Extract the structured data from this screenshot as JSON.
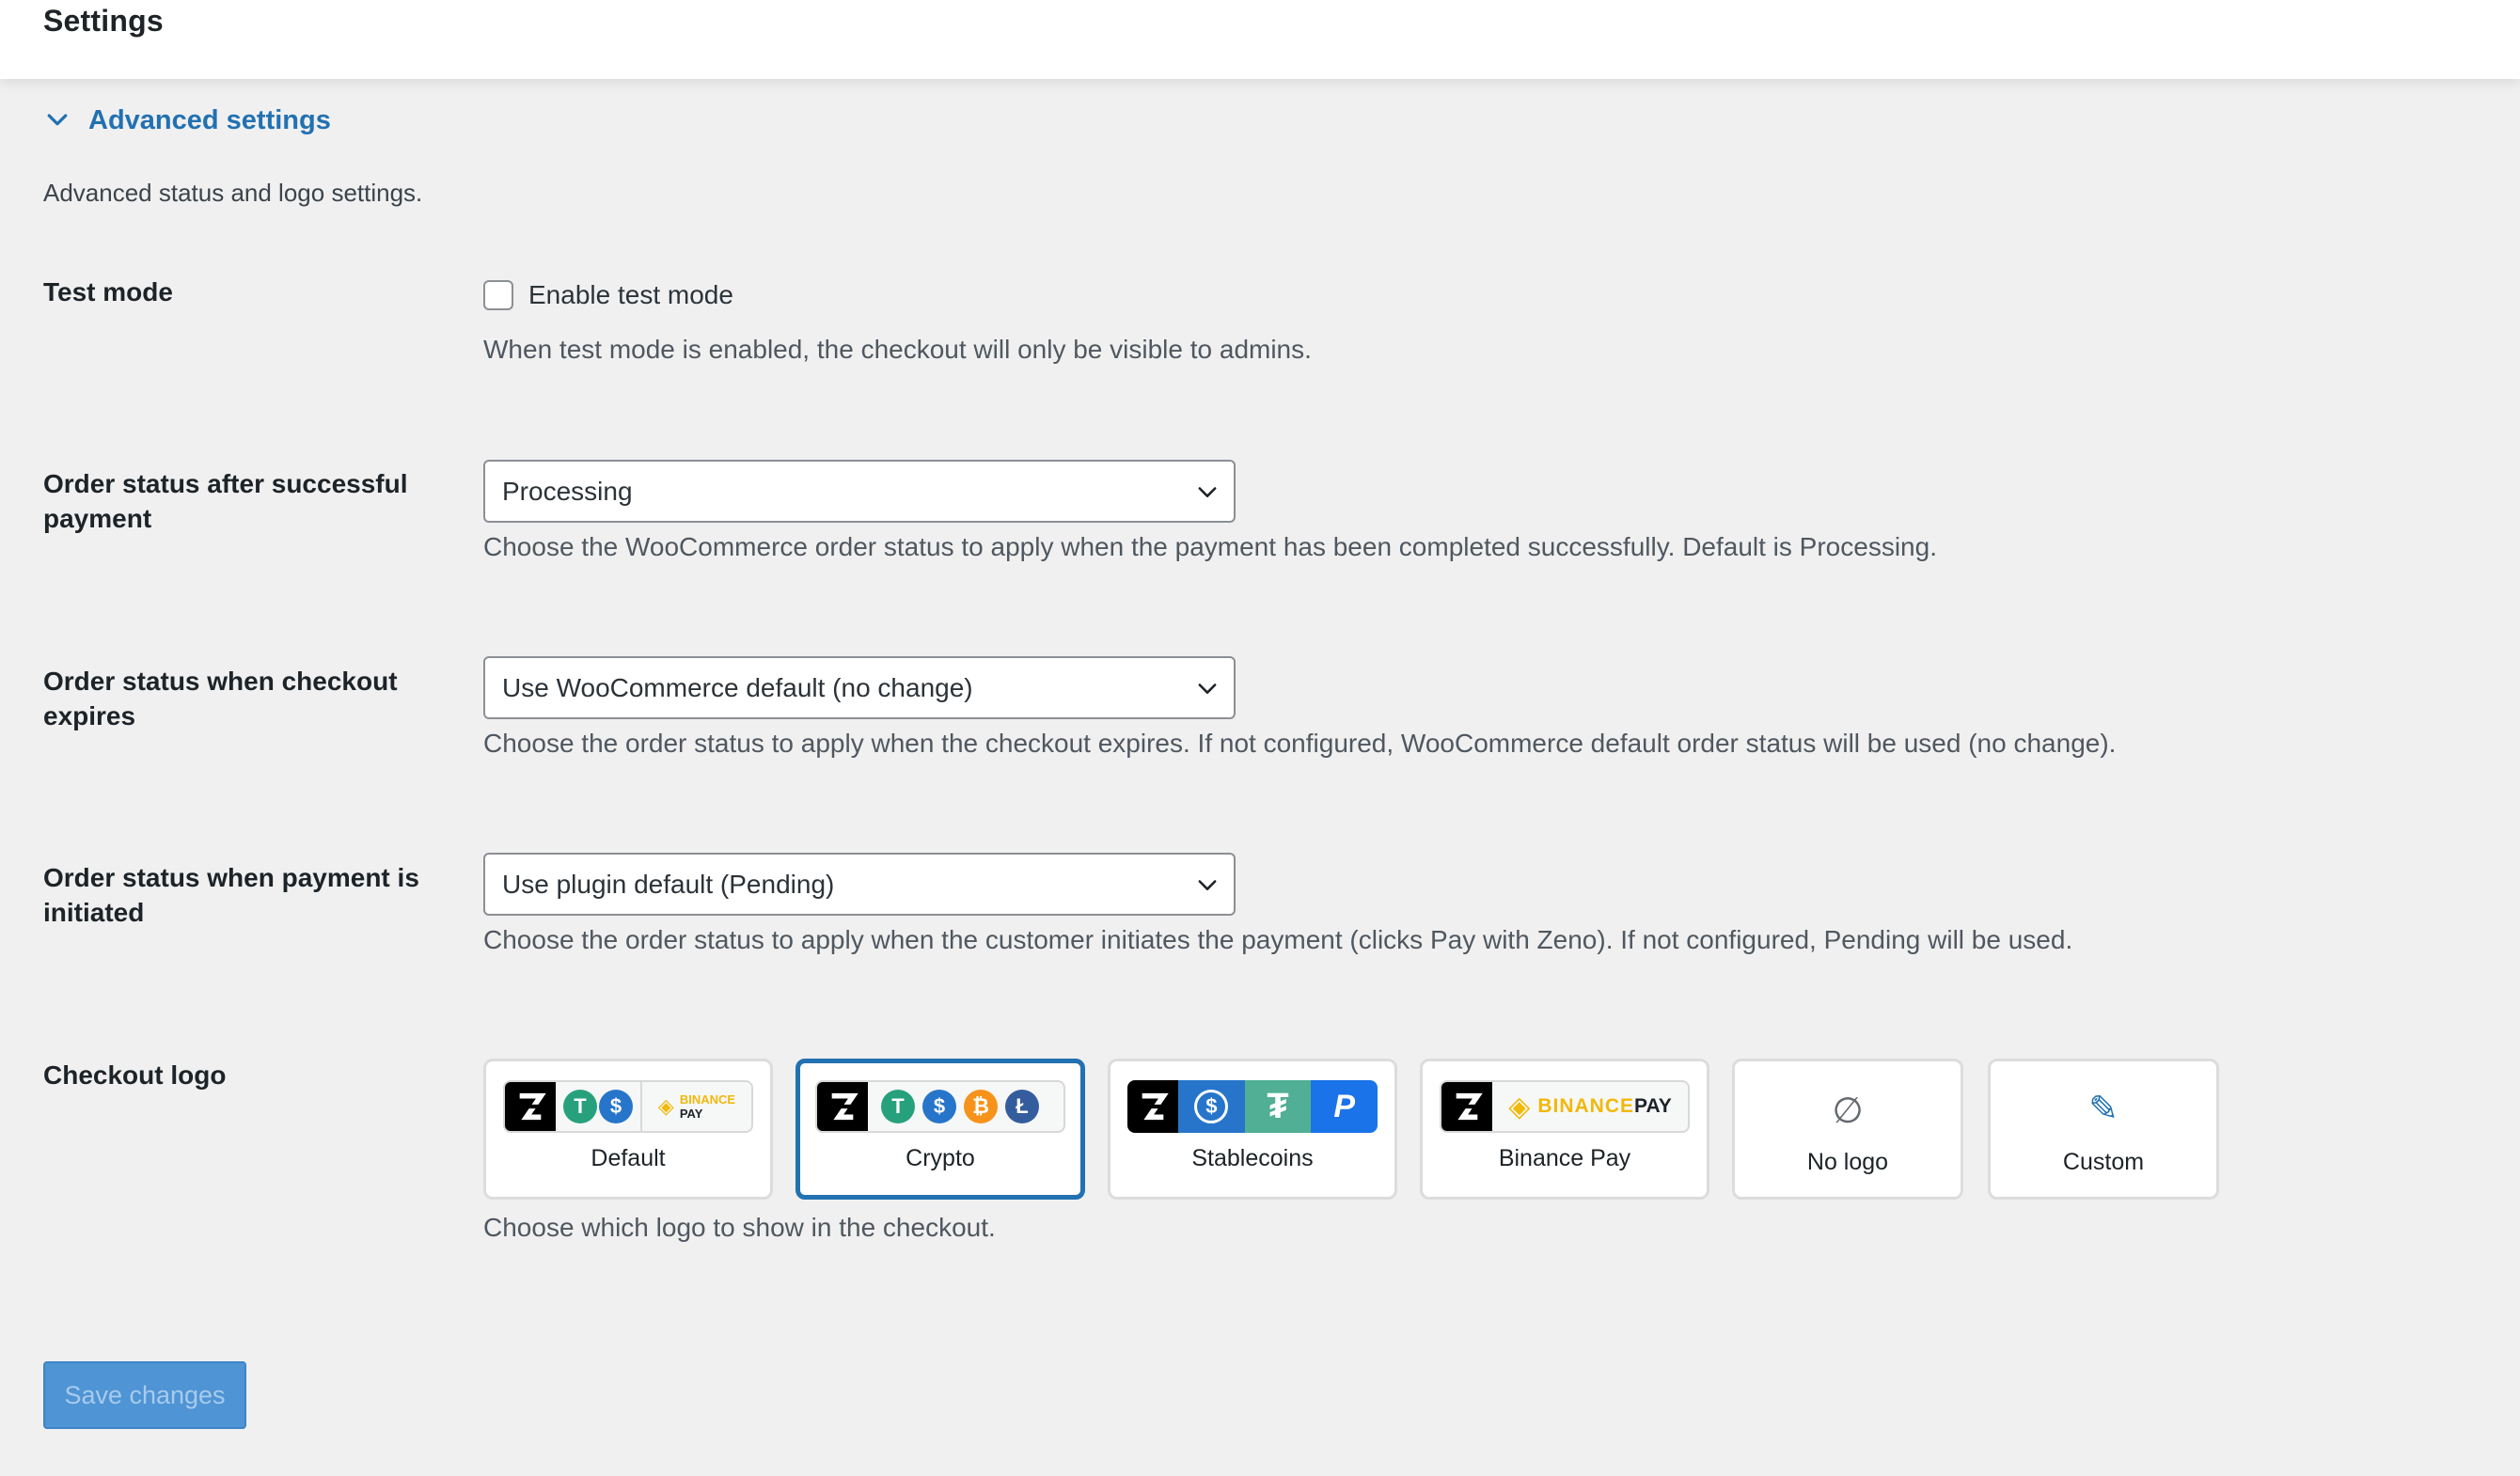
{
  "header": {
    "title": "Settings"
  },
  "advanced": {
    "toggle_label": "Advanced settings",
    "description": "Advanced status and logo settings."
  },
  "test_mode": {
    "label": "Test mode",
    "checkbox_label": "Enable test mode",
    "checked": false,
    "help": "When test mode is enabled, the checkout will only be visible to admins."
  },
  "order_success": {
    "label": "Order status after successful payment",
    "value": "Processing",
    "help": "Choose the WooCommerce order status to apply when the payment has been completed successfully. Default is Processing."
  },
  "order_expires": {
    "label": "Order status when checkout expires",
    "value": "Use WooCommerce default (no change)",
    "help": "Choose the order status to apply when the checkout expires. If not configured, WooCommerce default order status will be used (no change)."
  },
  "order_initiated": {
    "label": "Order status when payment is initiated",
    "value": "Use plugin default (Pending)",
    "help": "Choose the order status to apply when the customer initiates the payment (clicks Pay with Zeno). If not configured, Pending will be used."
  },
  "checkout_logo": {
    "label": "Checkout logo",
    "help": "Choose which logo to show in the checkout.",
    "selected": "Crypto",
    "options": [
      {
        "label": "Default",
        "binance_text": "BINANCE",
        "binance_pay": "PAY"
      },
      {
        "label": "Crypto"
      },
      {
        "label": "Stablecoins"
      },
      {
        "label": "Binance Pay",
        "binance_text": "BINANCE",
        "binance_pay": "PAY"
      },
      {
        "label": "No logo",
        "icon": "∅"
      },
      {
        "label": "Custom",
        "icon": "✎"
      }
    ]
  },
  "footer": {
    "save_label": "Save changes"
  },
  "colors": {
    "accent": "#2271b1",
    "button_bg": "#4f94d4",
    "tether": "#26a17b",
    "usdc": "#2775ca",
    "bitcoin": "#f7931a",
    "litecoin": "#345d9d",
    "binance": "#f0b90b",
    "paypal": "#1a73e8"
  }
}
